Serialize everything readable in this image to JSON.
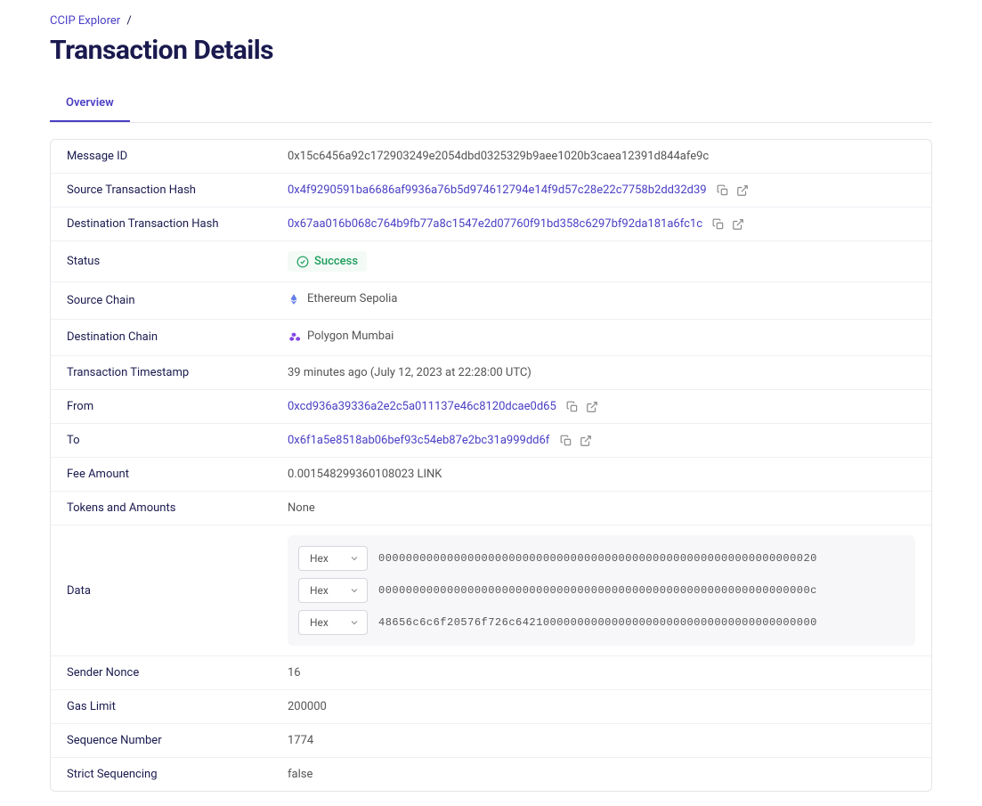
{
  "breadcrumb": {
    "root": "CCIP Explorer"
  },
  "page_title": "Transaction Details",
  "tabs": {
    "overview": "Overview"
  },
  "labels": {
    "message_id": "Message ID",
    "source_tx_hash": "Source Transaction Hash",
    "dest_tx_hash": "Destination Transaction Hash",
    "status": "Status",
    "source_chain": "Source Chain",
    "dest_chain": "Destination Chain",
    "timestamp": "Transaction Timestamp",
    "from": "From",
    "to": "To",
    "fee_amount": "Fee Amount",
    "tokens_amounts": "Tokens and Amounts",
    "data": "Data",
    "sender_nonce": "Sender Nonce",
    "gas_limit": "Gas Limit",
    "sequence_number": "Sequence Number",
    "strict_sequencing": "Strict Sequencing"
  },
  "values": {
    "message_id": "0x15c6456a92c172903249e2054dbd0325329b9aee1020b3caea12391d844afe9c",
    "source_tx_hash": "0x4f9290591ba6686af9936a76b5d974612794e14f9d57c28e22c7758b2dd32d39",
    "dest_tx_hash": "0x67aa016b068c764b9fb77a8c1547e2d07760f91bd358c6297bf92da181a6fc1c",
    "status": "Success",
    "source_chain": "Ethereum Sepolia",
    "dest_chain": "Polygon Mumbai",
    "timestamp": "39 minutes ago (July 12, 2023 at 22:28:00 UTC)",
    "from": "0xcd936a39336a2e2c5a011137e46c8120dcae0d65",
    "to": "0x6f1a5e8518ab06bef93c54eb87e2bc31a999dd6f",
    "fee_amount": "0.001548299360108023 LINK",
    "tokens_amounts": "None",
    "sender_nonce": "16",
    "gas_limit": "200000",
    "sequence_number": "1774",
    "strict_sequencing": "false"
  },
  "data_rows": {
    "format_label": "Hex",
    "0": "0000000000000000000000000000000000000000000000000000000000000020",
    "1": "000000000000000000000000000000000000000000000000000000000000000c",
    "2": "48656c6c6f20576f726c64210000000000000000000000000000000000000000"
  }
}
